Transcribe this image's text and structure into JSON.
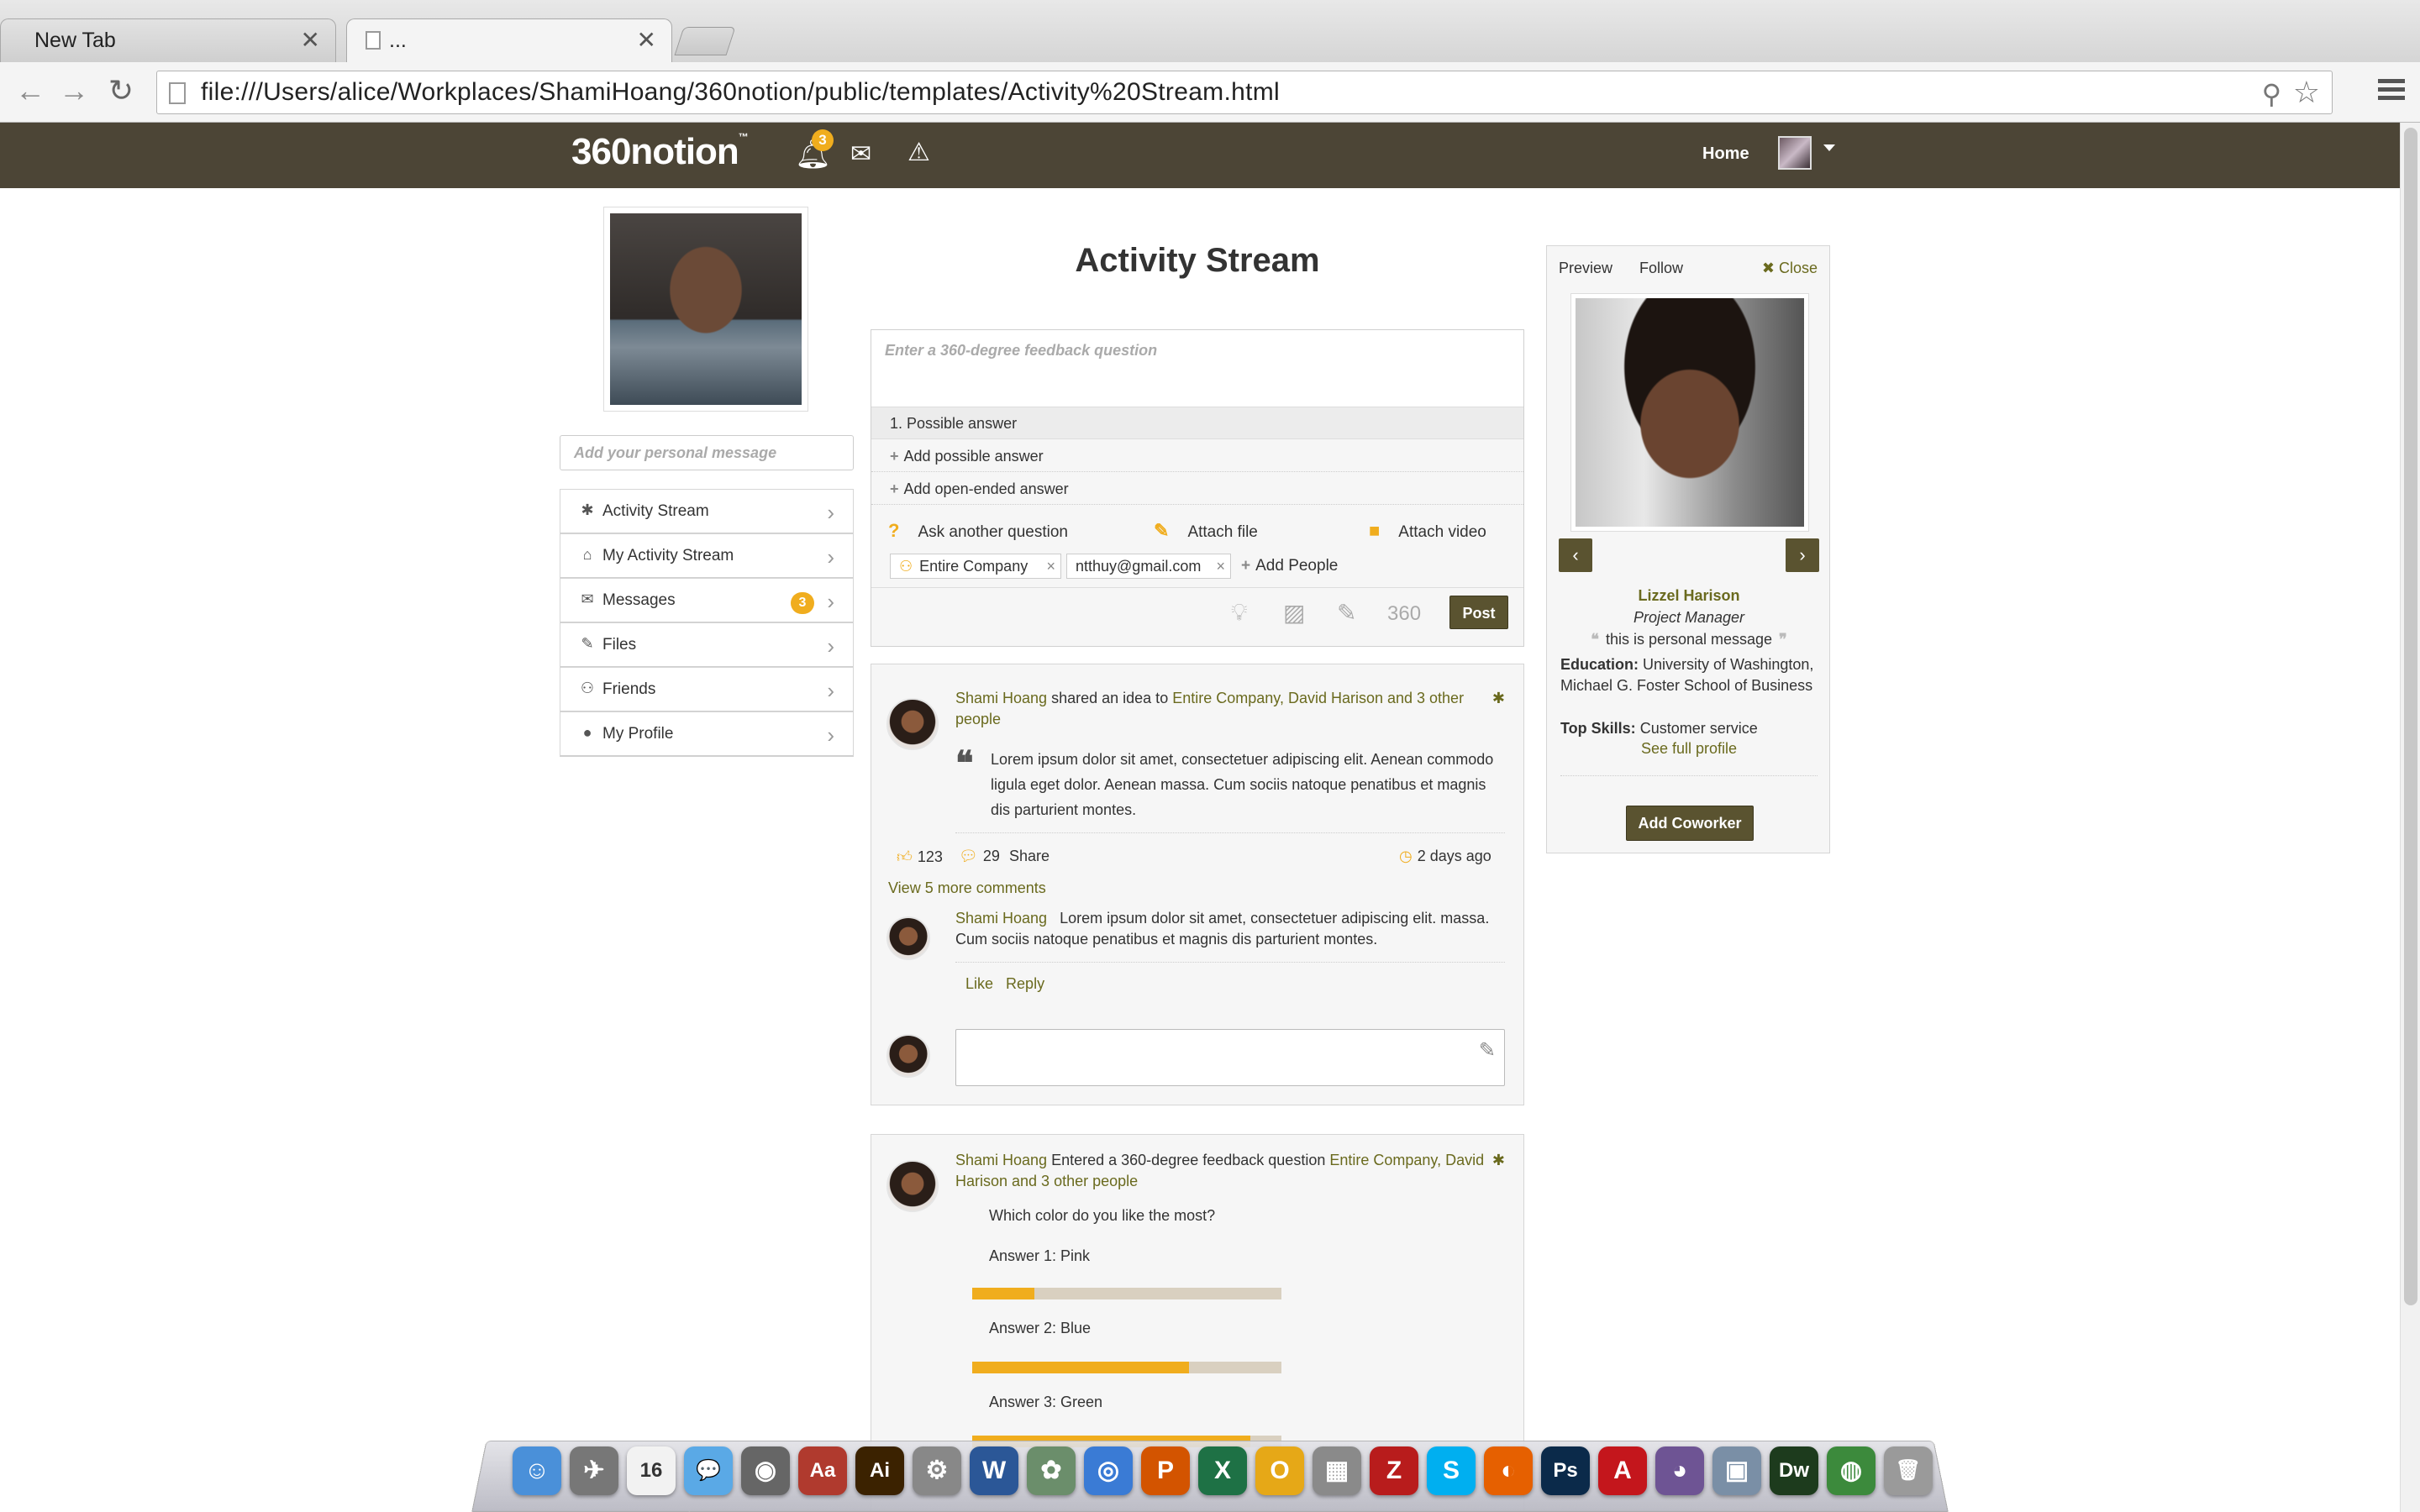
{
  "browser": {
    "tabs": [
      {
        "title": "New Tab",
        "active": false
      },
      {
        "title": "...",
        "active": true
      }
    ],
    "url": "file:///Users/alice/Workplaces/ShamiHoang/360notion/public/templates/Activity%20Stream.html",
    "close_glyph": "✕"
  },
  "header": {
    "logo": "360notion",
    "logo_tm": "™",
    "notification_count": "3",
    "home_label": "Home",
    "icons": [
      "bell-icon",
      "envelope-icon",
      "warning-icon"
    ]
  },
  "sidebar": {
    "personal_message_placeholder": "Add your personal message",
    "items": [
      {
        "label": "Activity Stream",
        "icon": "asterisk-icon",
        "glyph": "✱"
      },
      {
        "label": "My Activity Stream",
        "icon": "home-icon",
        "glyph": "⌂"
      },
      {
        "label": "Messages",
        "icon": "envelope-icon",
        "glyph": "✉",
        "badge": "3"
      },
      {
        "label": "Files",
        "icon": "paperclip-icon",
        "glyph": "✎"
      },
      {
        "label": "Friends",
        "icon": "users-icon",
        "glyph": "⚇"
      },
      {
        "label": "My Profile",
        "icon": "user-icon",
        "glyph": "●"
      }
    ],
    "chevron": "›"
  },
  "main": {
    "title": "Activity Stream",
    "composer": {
      "question_placeholder": "Enter a 360-degree feedback question",
      "answer_1": "1. Possible answer",
      "add_possible": "Add possible answer",
      "add_open": "Add open-ended answer",
      "ask_another": "Ask another question",
      "attach_file": "Attach file",
      "attach_video": "Attach video",
      "recipients": [
        "Entire Company",
        "ntthuy@gmail.com"
      ],
      "add_people": "Add People",
      "post_label": "Post",
      "tool_360": "360"
    },
    "feed": [
      {
        "author": "Shami Hoang",
        "action": "shared an idea to",
        "targets": "Entire Company, David Harison and 3 other people",
        "body": "Lorem ipsum dolor sit amet, consectetuer adipiscing elit. Aenean commodo ligula eget dolor. Aenean massa. Cum sociis natoque penatibus et magnis dis parturient montes.",
        "likes": "123",
        "comments": "29",
        "share": "Share",
        "time": "2 days ago",
        "view_more": "View 5 more comments",
        "comment": {
          "author": "Shami Hoang",
          "text": "Lorem ipsum dolor sit amet, consectetuer adipiscing elit. massa. Cum sociis natoque penatibus et magnis dis parturient montes.",
          "like": "Like",
          "reply": "Reply"
        }
      },
      {
        "author": "Shami Hoang",
        "action": "Entered a 360-degree feedback question",
        "targets_a": "Entire Company,",
        "targets_b": "David Harison and 3 other people",
        "question": "Which color do you like the most?",
        "answers": [
          {
            "label": "Answer 1: Pink",
            "share": 0.2
          },
          {
            "label": "Answer 2: Blue",
            "share": 0.7
          },
          {
            "label": "Answer 3: Green",
            "share": 0.9
          }
        ]
      }
    ]
  },
  "preview": {
    "preview_label": "Preview",
    "follow_label": "Follow",
    "close_label": "✖ Close",
    "name": "Lizzel Harison",
    "role": "Project Manager",
    "message": "this is personal message",
    "education_label": "Education:",
    "education": "University of Washington, Michael G. Foster School of Business",
    "skills_label": "Top Skills:",
    "skills": "Customer service",
    "full_profile": "See full profile",
    "add_coworker": "Add Coworker",
    "prev": "‹",
    "next": "›"
  },
  "dock": {
    "apps": [
      {
        "name": "finder-icon",
        "glyph": "☺",
        "color": "#4a90d9"
      },
      {
        "name": "launchpad-icon",
        "glyph": "✈",
        "color": "#777"
      },
      {
        "name": "calendar-icon",
        "glyph": "16",
        "color": "#f2f2f2"
      },
      {
        "name": "messages-icon",
        "glyph": "💬",
        "color": "#5aa9e6"
      },
      {
        "name": "facetime-icon",
        "glyph": "◉",
        "color": "#666"
      },
      {
        "name": "dictionary-icon",
        "glyph": "Aa",
        "color": "#b03a2e"
      },
      {
        "name": "illustrator-icon",
        "glyph": "Ai",
        "color": "#3b2200"
      },
      {
        "name": "system-preferences-icon",
        "glyph": "⚙",
        "color": "#888"
      },
      {
        "name": "word-icon",
        "glyph": "W",
        "color": "#2b5797"
      },
      {
        "name": "preview-icon",
        "glyph": "✿",
        "color": "#6b8e6b"
      },
      {
        "name": "safari-icon",
        "glyph": "◎",
        "color": "#3a7bd5"
      },
      {
        "name": "powerpoint-icon",
        "glyph": "P",
        "color": "#d35400"
      },
      {
        "name": "excel-icon",
        "glyph": "X",
        "color": "#1e7145"
      },
      {
        "name": "outlook-icon",
        "glyph": "O",
        "color": "#e6a817"
      },
      {
        "name": "scanner-icon",
        "glyph": "▦",
        "color": "#8a8a8a"
      },
      {
        "name": "filezilla-icon",
        "glyph": "Z",
        "color": "#b81c1c"
      },
      {
        "name": "skype-icon",
        "glyph": "S",
        "color": "#00aff0"
      },
      {
        "name": "firefox-icon",
        "glyph": "◐",
        "color": "#e66000"
      },
      {
        "name": "photoshop-icon",
        "glyph": "Ps",
        "color": "#0b2a4a"
      },
      {
        "name": "acrobat-icon",
        "glyph": "A",
        "color": "#c4161c"
      },
      {
        "name": "github-icon",
        "glyph": "◕",
        "color": "#6e5494"
      },
      {
        "name": "photo-icon",
        "glyph": "▣",
        "color": "#7a8fa6"
      },
      {
        "name": "dreamweaver-icon",
        "glyph": "Dw",
        "color": "#1d3b1d"
      },
      {
        "name": "chrome-icon",
        "glyph": "◍",
        "color": "#3c8a3c"
      },
      {
        "name": "trash-icon",
        "glyph": "🗑",
        "color": "#9a9a9a"
      }
    ]
  }
}
